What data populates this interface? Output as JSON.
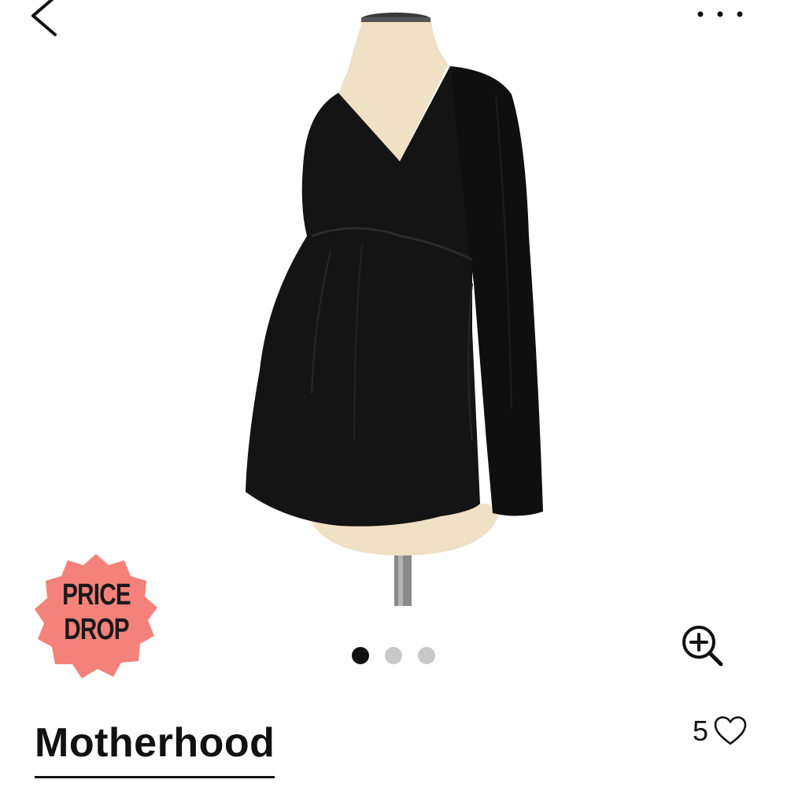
{
  "header": {
    "back_icon": "chevron-left-icon",
    "more_icon": "more-horizontal-icon"
  },
  "product": {
    "image_description_icon": "product-photo",
    "badge": {
      "line1": "PRICE",
      "line2": "DROP",
      "color": "#F4827A"
    },
    "gallery": {
      "total": 3,
      "active_index": 0
    },
    "zoom_icon": "zoom-in-icon",
    "brand": "Motherhood",
    "likes": "5",
    "like_icon": "heart-outline-icon"
  },
  "colors": {
    "text": "#111111",
    "dot_inactive": "#C8C8C8",
    "dot_active": "#111111",
    "mannequin": "#EFE0C6",
    "garment": "#141414"
  }
}
